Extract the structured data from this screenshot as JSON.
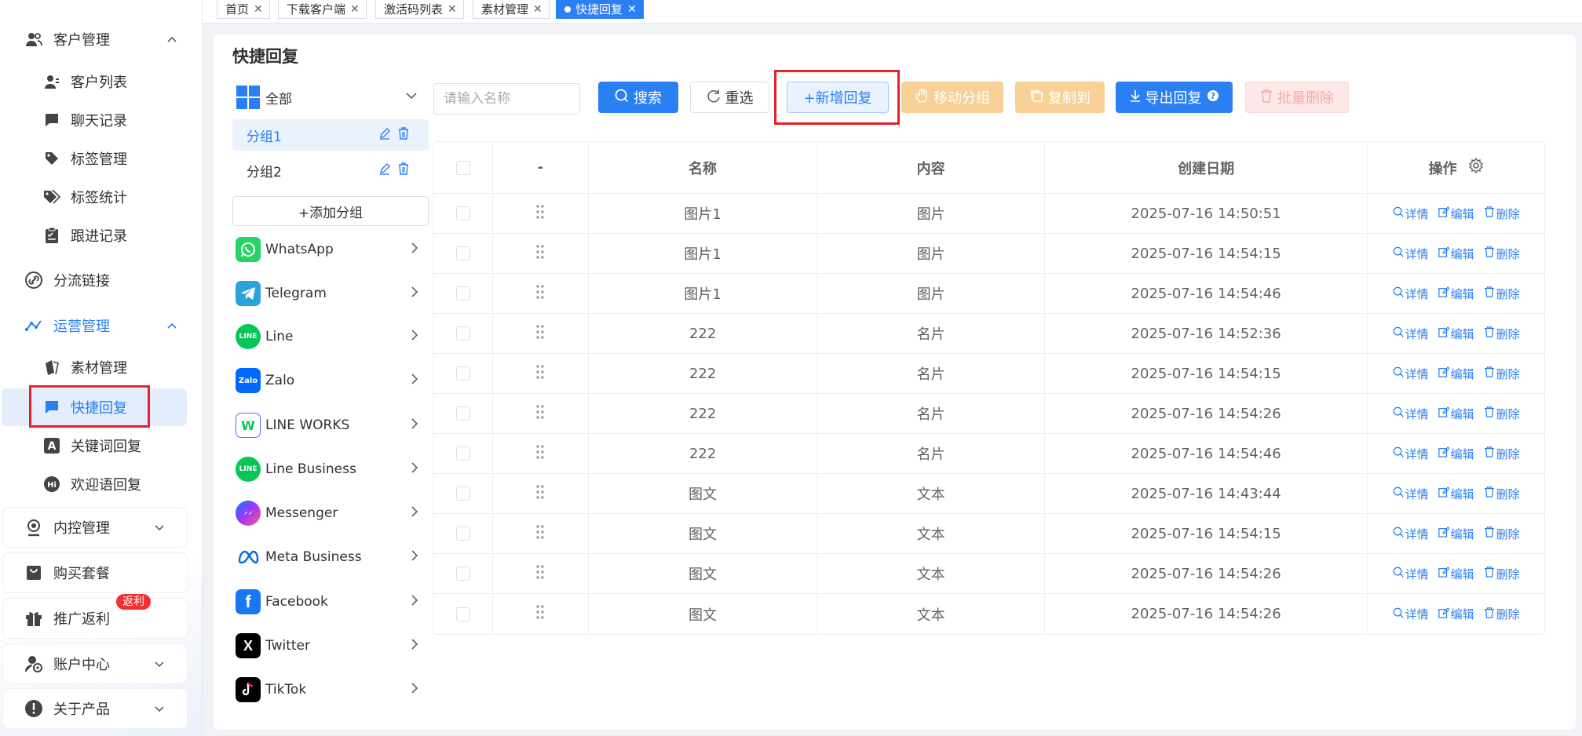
{
  "sidebar": {
    "groups": [
      {
        "label": "客户管理",
        "icon": "users-icon",
        "expanded": true,
        "items": [
          {
            "label": "客户列表",
            "icon": "user-icon"
          },
          {
            "label": "聊天记录",
            "icon": "chat-icon"
          },
          {
            "label": "标签管理",
            "icon": "tag-icon"
          },
          {
            "label": "标签统计",
            "icon": "tags-icon"
          },
          {
            "label": "跟进记录",
            "icon": "clipboard-icon"
          }
        ]
      },
      {
        "label": "分流链接",
        "icon": "link-icon"
      },
      {
        "label": "运营管理",
        "icon": "nodes-icon",
        "expanded": true,
        "items": [
          {
            "label": "素材管理",
            "icon": "material-icon"
          },
          {
            "label": "快捷回复",
            "icon": "chat-icon"
          },
          {
            "label": "关键词回复",
            "icon": "letter-a-icon"
          },
          {
            "label": "欢迎语回复",
            "icon": "hi-icon"
          }
        ]
      },
      {
        "label": "内控管理",
        "icon": "shield-user-icon"
      },
      {
        "label": "购买套餐",
        "icon": "bag-icon"
      },
      {
        "label": "推广返利",
        "icon": "gift-icon",
        "badge": "返利"
      },
      {
        "label": "账户中心",
        "icon": "account-icon"
      },
      {
        "label": "关于产品",
        "icon": "info-icon"
      }
    ]
  },
  "tabs": [
    {
      "label": "首页"
    },
    {
      "label": "下载客户端"
    },
    {
      "label": "激活码列表"
    },
    {
      "label": "素材管理"
    },
    {
      "label": "快捷回复",
      "active": true
    }
  ],
  "page": {
    "title": "快捷回复"
  },
  "groups": {
    "all_label": "全部",
    "items": [
      {
        "label": "分组1",
        "selected": true
      },
      {
        "label": "分组2"
      }
    ],
    "add_label": "+添加分组"
  },
  "platforms": [
    {
      "label": "WhatsApp",
      "color": "#25d366",
      "icon": "whatsapp-icon"
    },
    {
      "label": "Telegram",
      "color": "#2aa3dc",
      "icon": "telegram-icon"
    },
    {
      "label": "Line",
      "color": "#06c755",
      "icon": "line-icon"
    },
    {
      "label": "Zalo",
      "color": "#0068ff",
      "icon": "zalo-icon"
    },
    {
      "label": "LINE WORKS",
      "color": "#4a6cf7",
      "icon": "lineworks-icon"
    },
    {
      "label": "Line Business",
      "color": "#06c755",
      "icon": "line-business-icon"
    },
    {
      "label": "Messenger",
      "color": "#a334fa",
      "icon": "messenger-icon"
    },
    {
      "label": "Meta Business",
      "color": "#0668e1",
      "icon": "meta-icon"
    },
    {
      "label": "Facebook",
      "color": "#1877f2",
      "icon": "facebook-icon"
    },
    {
      "label": "Twitter",
      "color": "#000000",
      "icon": "x-icon"
    },
    {
      "label": "TikTok",
      "color": "#000000",
      "icon": "tiktok-icon"
    }
  ],
  "toolbar": {
    "search_placeholder": "请输入名称",
    "search_label": "搜索",
    "reset_label": "重选",
    "add_label": "+新增回复",
    "move_label": "移动分组",
    "copy_label": "复制到",
    "export_label": "导出回复",
    "batch_delete_label": "批量删除"
  },
  "table": {
    "headers": [
      "-",
      "名称",
      "内容",
      "创建日期",
      "操作"
    ],
    "actions": [
      "详情",
      "编辑",
      "删除"
    ],
    "rows": [
      {
        "name": "图片1",
        "content": "图片",
        "date": "2025-07-16 14:50:51"
      },
      {
        "name": "图片1",
        "content": "图片",
        "date": "2025-07-16 14:54:15"
      },
      {
        "name": "图片1",
        "content": "图片",
        "date": "2025-07-16 14:54:46"
      },
      {
        "name": "222",
        "content": "名片",
        "date": "2025-07-16 14:52:36"
      },
      {
        "name": "222",
        "content": "名片",
        "date": "2025-07-16 14:54:15"
      },
      {
        "name": "222",
        "content": "名片",
        "date": "2025-07-16 14:54:26"
      },
      {
        "name": "222",
        "content": "名片",
        "date": "2025-07-16 14:54:46"
      },
      {
        "name": "图文",
        "content": "文本",
        "date": "2025-07-16 14:43:44"
      },
      {
        "name": "图文",
        "content": "文本",
        "date": "2025-07-16 14:54:15"
      },
      {
        "name": "图文",
        "content": "文本",
        "date": "2025-07-16 14:54:26"
      },
      {
        "name": "图文",
        "content": "文本",
        "date": "2025-07-16 14:54:26"
      }
    ]
  },
  "colors": {
    "primary": "#2a7ff3",
    "warning_disabled": "#f7d195",
    "danger_disabled": "#fde9e9",
    "highlight": "#e5212b"
  }
}
